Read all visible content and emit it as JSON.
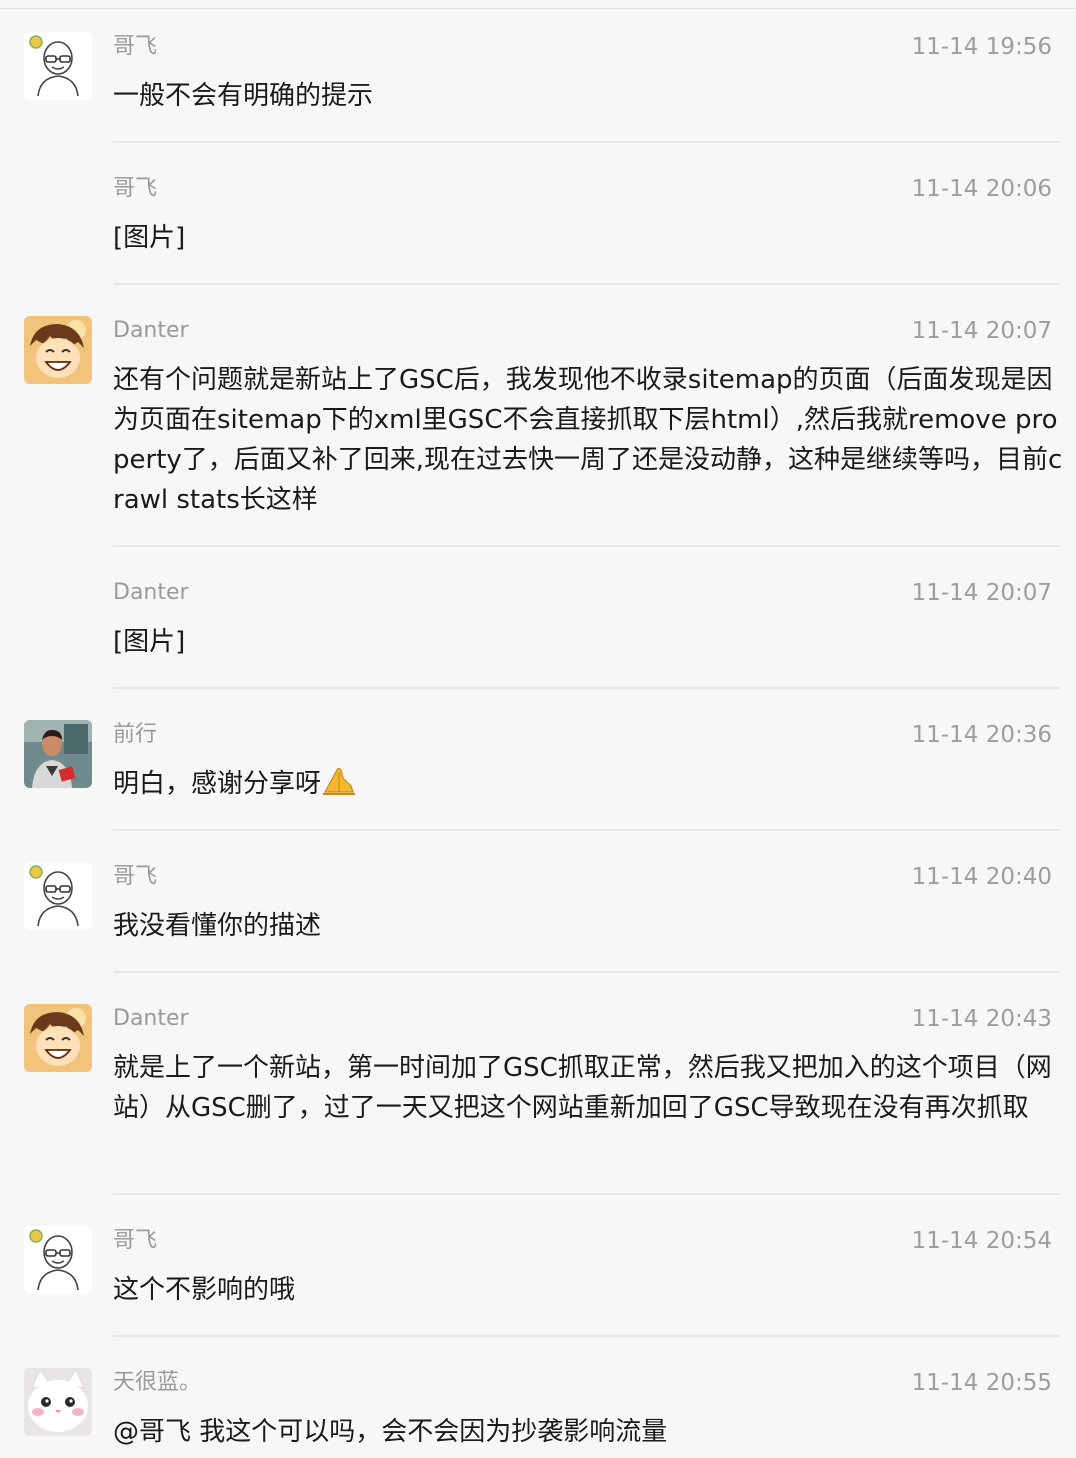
{
  "messages": [
    {
      "sender": "哥飞",
      "time": "11-14 19:56",
      "text": "一般不会有明确的提示",
      "avatar": "bald-man-glasses-avatar"
    },
    {
      "sender": "哥飞",
      "time": "11-14 20:06",
      "text": "[图片]",
      "avatar": ""
    },
    {
      "sender": "Danter",
      "time": "11-14 20:07",
      "text": "还有个问题就是新站上了GSC后，我发现他不收录sitemap的页面（后面发现是因为页面在sitemap下的xml里GSC不会直接抓取下层html）,然后我就remove property了，后面又补了回来,现在过去快一周了还是没动静，这种是继续等吗，目前crawl stats长这样",
      "avatar": "smiling-anime-boy-avatar"
    },
    {
      "sender": "Danter",
      "time": "11-14 20:07",
      "text": "[图片]",
      "avatar": ""
    },
    {
      "sender": "前行",
      "time": "11-14 20:36",
      "text": "明白，感谢分享呀",
      "avatar": "man-photo-avatar",
      "emoji": "praying-hands-icon"
    },
    {
      "sender": "哥飞",
      "time": "11-14 20:40",
      "text": "我没看懂你的描述",
      "avatar": "bald-man-glasses-avatar"
    },
    {
      "sender": "Danter",
      "time": "11-14 20:43",
      "text": "就是上了一个新站，第一时间加了GSC抓取正常，然后我又把加入的这个项目（网站）从GSC删了，过了一天又把这个网站重新加回了GSC导致现在没有再次抓取",
      "avatar": "smiling-anime-boy-avatar"
    },
    {
      "sender": "哥飞",
      "time": "11-14 20:54",
      "text": "这个不影响的哦",
      "avatar": "bald-man-glasses-avatar"
    },
    {
      "sender": "天很蓝。",
      "time": "11-14 20:55",
      "text": "@哥飞 我这个可以吗，会不会因为抄袭影响流量",
      "avatar": "white-kitten-avatar"
    }
  ]
}
